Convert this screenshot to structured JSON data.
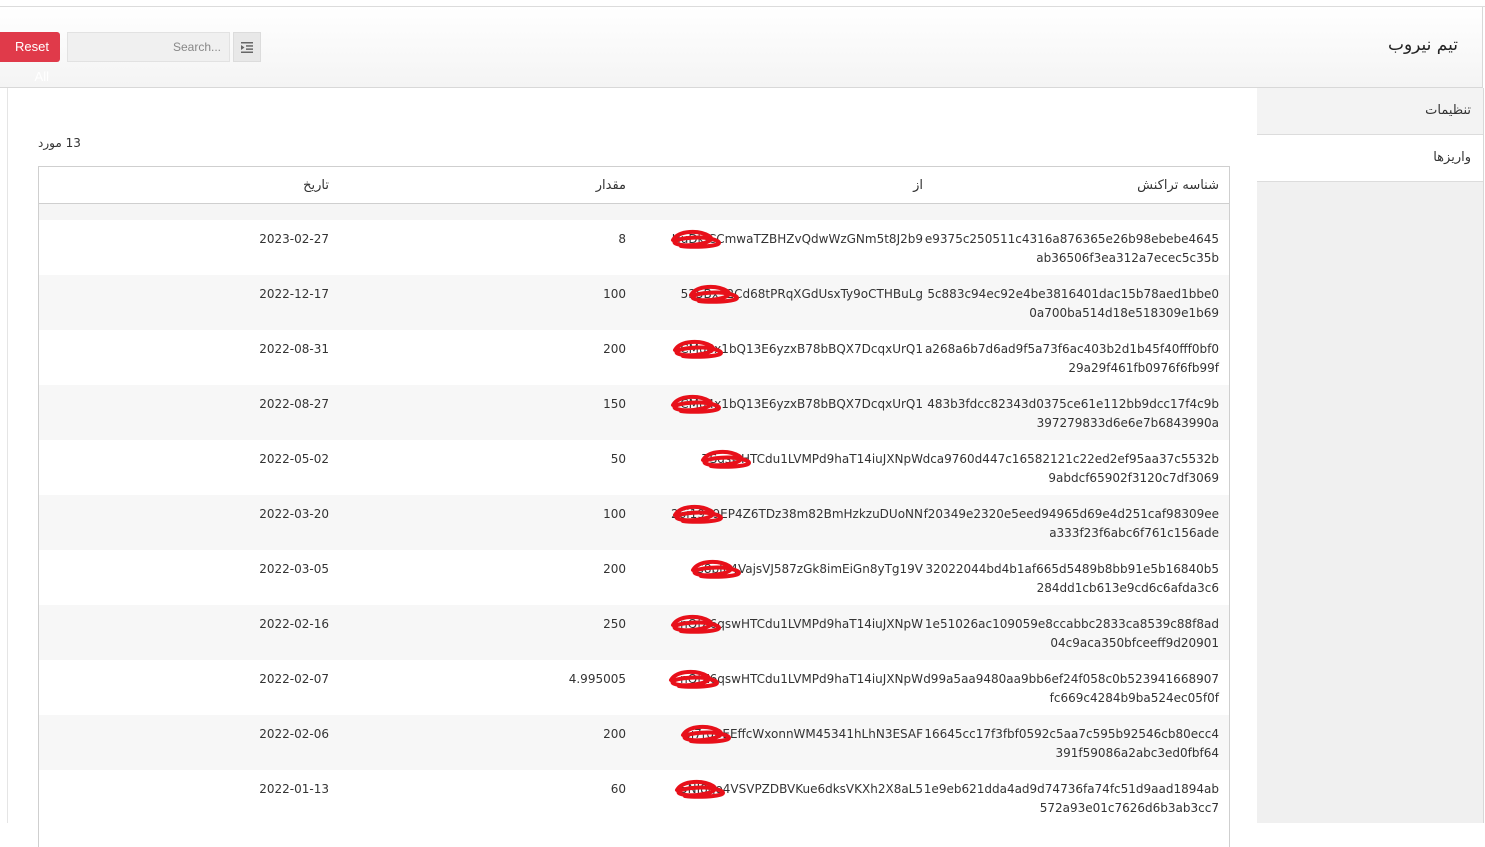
{
  "header": {
    "app_title": "تیم نیروب",
    "reset_label": "Reset All",
    "search_placeholder": "Search..."
  },
  "sidebar": {
    "items": [
      {
        "label": "تنظیمات",
        "active": false
      },
      {
        "label": "واریزها",
        "active": true
      }
    ]
  },
  "main": {
    "count_text": "13 مورد",
    "columns": [
      "شناسه تراکنش",
      "از",
      "مقدار",
      "تاریخ"
    ],
    "rows": [
      {
        "id_line1": "e9375c250511c4316a876365e26b98ebebe4645",
        "id_line2": "ab36506f3ea312a7ecec5c35b",
        "from": "HuDkiCCmwaTZBHZvQdwWzGNm5t8J2b9",
        "amount": "8",
        "date": "2023-02-27"
      },
      {
        "id_line1": "5c883c94ec92e4be3816401dac15b78aed1bbe0",
        "id_line2": "0a700ba514d18e518309e1b69",
        "from": "535Bx32Cd68tPRqXGdUsxTy9oCTHBuLg",
        "amount": "100",
        "date": "2022-12-17"
      },
      {
        "id_line1": "a268a6b7d6ad9f5a73f6ac403b2d1b45f40fff0bf0",
        "id_line2": "29a29f461fb0976f6fb99f",
        "from": "CMu4x1bQ13E6yzxB78bBQX7DcqxUrQ1",
        "amount": "200",
        "date": "2022-08-31"
      },
      {
        "id_line1": "483b3fdcc82343d0375ce61e112bb9dcc17f4c9b",
        "id_line2": "397279833d6e6e7b6843990a",
        "from": "CMu4x1bQ13E6yzxB78bBQX7DcqxUrQ1",
        "amount": "150",
        "date": "2022-08-27"
      },
      {
        "id_line1": "dca9760d447c16582121c22ed2ef95aa37c5532b",
        "id_line2": "9abdcf65902f3120c7df3069",
        "from": "TSqswHTCdu1LVMPd9haT14iuJXNpW",
        "amount": "50",
        "date": "2022-05-02"
      },
      {
        "id_line1": "f20349e2320e5eed94965d69e4d251caf98309ee",
        "id_line2": "a333f23f6abc6f761c156ade",
        "from": "26i1939EP4Z6TDz38m82BmHzkzuDUoNN",
        "amount": "100",
        "date": "2022-03-20"
      },
      {
        "id_line1": "32022044bd4b1af665d5489b8bb91e5b16840b5",
        "id_line2": "284dd1cb613e9cd6c6afda3c6",
        "from": "G8pJh4VajsVJ587zGk8imEiGn8yTg19V",
        "amount": "200",
        "date": "2022-03-05"
      },
      {
        "id_line1": "1e51026ac109059e8ccabbc2833ca8539c88f8ad",
        "id_line2": "04c9aca350bfceeff9d20901",
        "from": "nQfZ6qswHTCdu1LVMPd9haT14iuJXNpW",
        "amount": "250",
        "date": "2022-02-16"
      },
      {
        "id_line1": "d99a5aa9480aa9bb6ef24f058c0b523941668907",
        "id_line2": "fc669c4284b9ba524ec05f0f",
        "from": "nQfZ6qswHTCdu1LVMPd9haT14iuJXNpW",
        "amount": "4.995005",
        "date": "2022-02-07"
      },
      {
        "id_line1": "16645cc17f3fbf0592c5aa7c595b92546cb80ecc4",
        "id_line2": "391f59086a2abc3ed0fbf64",
        "from": "6j7rgBEEffcWxonnWM45341hLhN3ESAF",
        "amount": "200",
        "date": "2022-02-06"
      },
      {
        "id_line1": "1e9eb621dda4ad9d74736fa74fc51d9aad1894ab",
        "id_line2": "572a93e01c7626d6b3ab3cc7",
        "from": "5NJ8qo4VSVPZDBVKue6dksVKXh2X8aL5",
        "amount": "60",
        "date": "2022-01-13"
      }
    ]
  },
  "colors": {
    "accent_red": "#e03a4a",
    "scribble_red": "#e8101a"
  },
  "icons": {
    "toggle": "indent-list-icon"
  }
}
